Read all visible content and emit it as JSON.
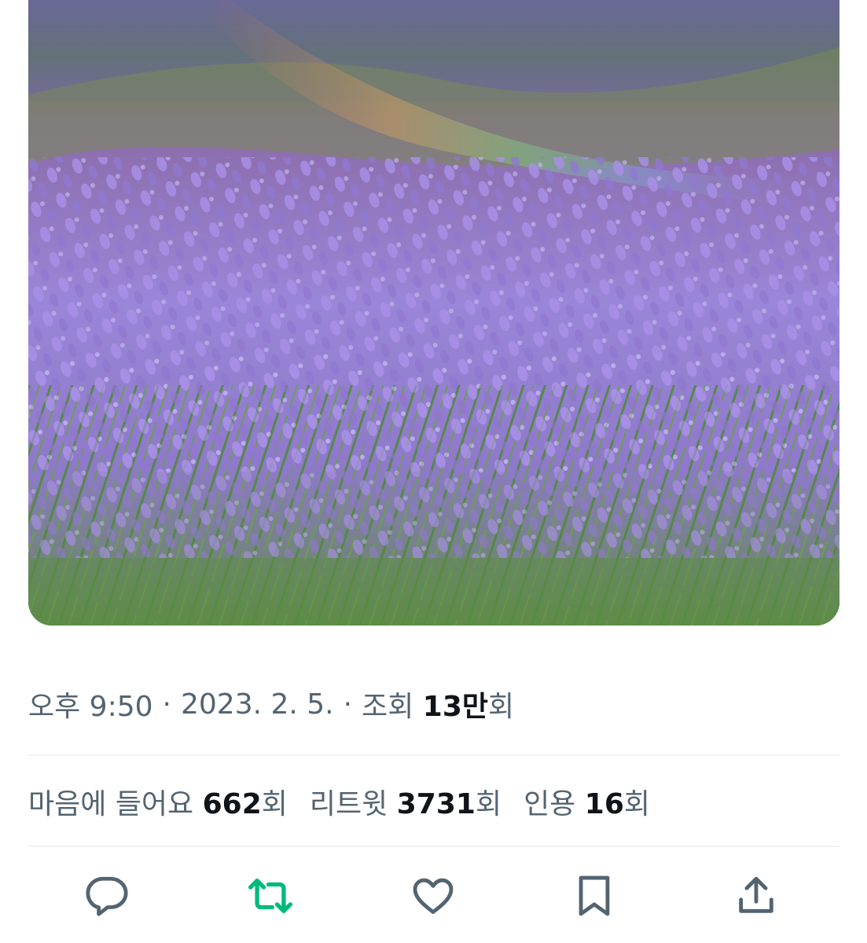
{
  "tweet": {
    "media": {
      "alt_subject": "lavender field"
    },
    "meta": {
      "time": "오후 9:50",
      "separator": "·",
      "date": "2023. 2. 5.",
      "views_label": "조회",
      "views_count": "13만",
      "views_suffix": "회"
    },
    "stats": {
      "likes_label": "마음에 들어요",
      "likes_count": "662",
      "likes_suffix": "회",
      "retweets_label": "리트윗",
      "retweets_count": "3731",
      "retweets_suffix": "회",
      "quotes_label": "인용",
      "quotes_count": "16",
      "quotes_suffix": "회"
    },
    "actions": [
      {
        "name": "reply",
        "icon": "reply-icon",
        "color": "#536471"
      },
      {
        "name": "retweet",
        "icon": "retweet-icon",
        "color": "#00ba7c"
      },
      {
        "name": "like",
        "icon": "heart-icon",
        "color": "#536471"
      },
      {
        "name": "bookmark",
        "icon": "bookmark-icon",
        "color": "#536471"
      },
      {
        "name": "share",
        "icon": "share-icon",
        "color": "#536471"
      }
    ]
  }
}
